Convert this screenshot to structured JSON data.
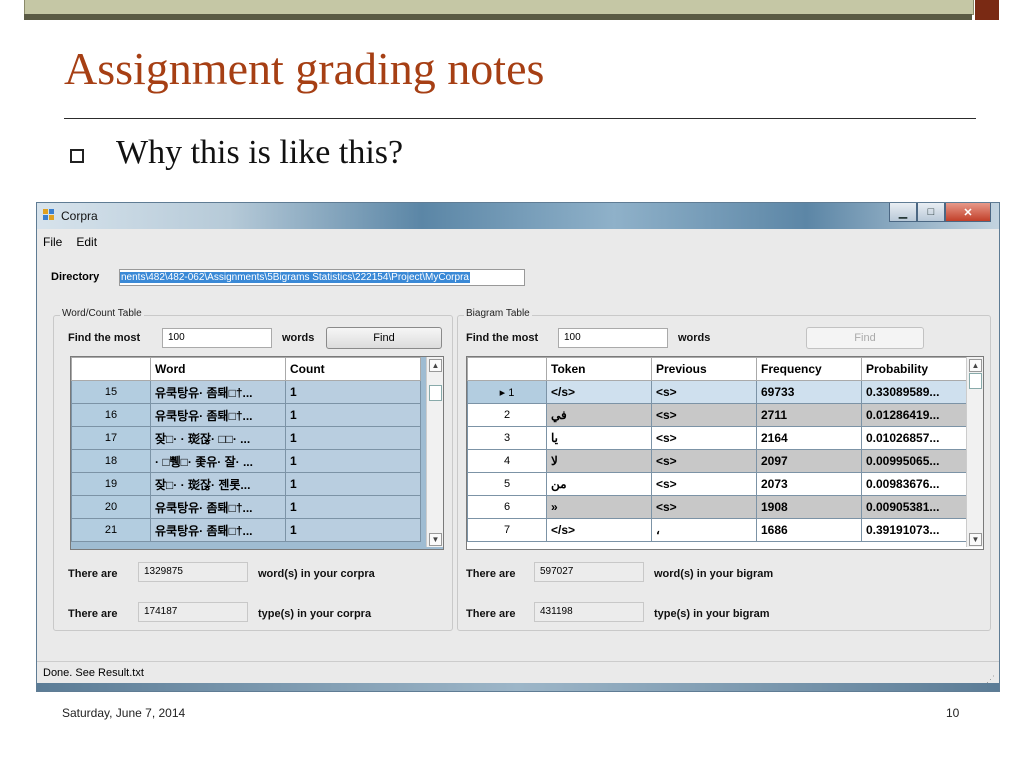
{
  "slide": {
    "title": "Assignment grading notes",
    "bullet": "Why this is like this?",
    "date": "Saturday, June 7, 2014",
    "page": "10"
  },
  "window": {
    "title": "Corpra",
    "menu": [
      "File",
      "Edit"
    ],
    "directory_label": "Directory",
    "directory_value": "nents\\482\\482-062\\Assignments\\5Bigrams Statistics\\222154\\Project\\MyCorpra",
    "status": "Done. See Result.txt"
  },
  "word_panel": {
    "legend": "Word/Count Table",
    "find_label": "Find the most",
    "find_value": "100",
    "words_label": "words",
    "find_button": "Find",
    "columns": [
      "Word",
      "Count"
    ],
    "rows": [
      {
        "n": "15",
        "word": "유쿡탕유· 좀퇘□†...",
        "count": "1"
      },
      {
        "n": "16",
        "word": "유쿡탕유· 좀퇘□†...",
        "count": "1"
      },
      {
        "n": "17",
        "word": "잦□· · 珳잖· □□· ...",
        "count": "1"
      },
      {
        "n": "18",
        "word": "· □쀙□· 좇유· 잘· ...",
        "count": "1"
      },
      {
        "n": "19",
        "word": "잦□· · 珳잖· 젠롯...",
        "count": "1"
      },
      {
        "n": "20",
        "word": "유쿡탕유· 좀퇘□†...",
        "count": "1"
      },
      {
        "n": "21",
        "word": "유쿡탕유· 좀퇘□†...",
        "count": "1"
      }
    ],
    "there_are": "There are",
    "words_count": "1329875",
    "words_suffix": "word(s) in your corpra",
    "types_count": "174187",
    "types_suffix": "type(s) in your corpra"
  },
  "bigram_panel": {
    "legend": "Biagram Table",
    "find_label": "Find the most",
    "find_value": "100",
    "words_label": "words",
    "find_button": "Find",
    "columns": [
      "Token",
      "Previous",
      "Frequency",
      "Probability"
    ],
    "rows": [
      {
        "n": "1",
        "token": "</s>",
        "prev": "<s>",
        "freq": "69733",
        "prob": "0.33089589..."
      },
      {
        "n": "2",
        "token": "في",
        "prev": "<s>",
        "freq": "2711",
        "prob": "0.01286419..."
      },
      {
        "n": "3",
        "token": "يا",
        "prev": "<s>",
        "freq": "2164",
        "prob": "0.01026857..."
      },
      {
        "n": "4",
        "token": "لا",
        "prev": "<s>",
        "freq": "2097",
        "prob": "0.00995065..."
      },
      {
        "n": "5",
        "token": "من",
        "prev": "<s>",
        "freq": "2073",
        "prob": "0.00983676..."
      },
      {
        "n": "6",
        "token": "»",
        "prev": "<s>",
        "freq": "1908",
        "prob": "0.00905381..."
      },
      {
        "n": "7",
        "token": "</s>",
        "prev": "،",
        "freq": "1686",
        "prob": "0.39191073..."
      }
    ],
    "there_are": "There are",
    "words_count": "597027",
    "words_suffix": "word(s) in your bigram",
    "types_count": "431198",
    "types_suffix": "type(s) in your bigram"
  }
}
